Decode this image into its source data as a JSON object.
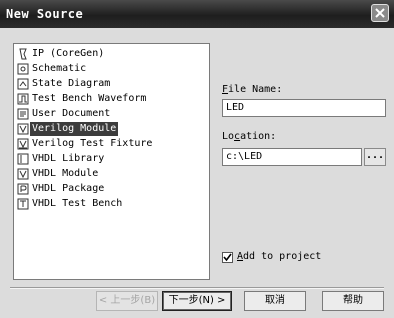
{
  "window": {
    "title": "New Source",
    "close_icon": "close-icon"
  },
  "source_types": [
    {
      "label": "IP (CoreGen)",
      "icon": "ip-core-icon",
      "selected": false
    },
    {
      "label": "Schematic",
      "icon": "schematic-icon",
      "selected": false
    },
    {
      "label": "State Diagram",
      "icon": "state-diagram-icon",
      "selected": false
    },
    {
      "label": "Test Bench Waveform",
      "icon": "waveform-icon",
      "selected": false
    },
    {
      "label": "User Document",
      "icon": "document-icon",
      "selected": false
    },
    {
      "label": "Verilog Module",
      "icon": "verilog-module-icon",
      "selected": true
    },
    {
      "label": "Verilog Test Fixture",
      "icon": "test-fixture-icon",
      "selected": false
    },
    {
      "label": "VHDL Library",
      "icon": "library-icon",
      "selected": false
    },
    {
      "label": "VHDL Module",
      "icon": "vhdl-module-icon",
      "selected": false
    },
    {
      "label": "VHDL Package",
      "icon": "package-icon",
      "selected": false
    },
    {
      "label": "VHDL Test Bench",
      "icon": "test-bench-icon",
      "selected": false
    }
  ],
  "file_name": {
    "label_first": "F",
    "label_rest": "ile Name:",
    "value": "LED"
  },
  "location": {
    "label_first": "Lo",
    "label_mid": "c",
    "label_rest": "ation:",
    "value": "c:\\LED",
    "browse_label": "..."
  },
  "add_to_project": {
    "label_first": "A",
    "label_rest": "dd to project",
    "checked": true
  },
  "buttons": {
    "back": "< 上一步(B)",
    "next": "下一步(N) >",
    "cancel": "取消",
    "help": "帮助"
  }
}
